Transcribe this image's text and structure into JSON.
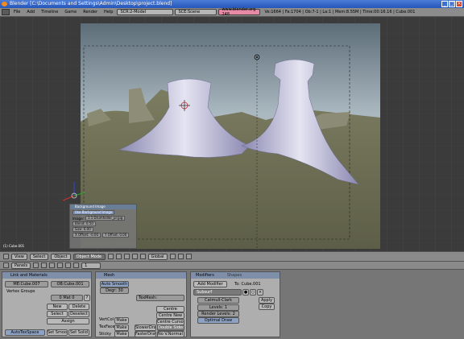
{
  "window": {
    "title": "Blender [C:\\Documents and Settings\\Admin\\Desktop\\project.blend]"
  },
  "menubar": {
    "menus": [
      "File",
      "Add",
      "Timeline",
      "Game",
      "Render",
      "Help"
    ],
    "screen": "SCR:2-Model",
    "scene": "SCE:Scene",
    "url": "www.blender.org 248",
    "stats": "Ve:1664 | Fa:1704 | Ob:7-1 | La:1 | Mem:8.55M | Time:00:16.16 | Cube.001"
  },
  "viewport": {
    "object_label": "(1) Cube.001"
  },
  "bg_panel": {
    "header": "Background Image",
    "use_label": "Use Background Image",
    "image_label": "Image:",
    "image_file": "1.1 Drumheller_pr.jpg",
    "blend_label": "Blend: 0.50",
    "size_label": "Size: 6.00",
    "xoff_label": "X Offset: -0.00",
    "yoff_label": "Y Offset: 0.00"
  },
  "header3d": {
    "view": "View",
    "select": "Select",
    "object": "Object",
    "mode": "Object Mode",
    "orientation": "Global"
  },
  "headerbtns": {
    "panels": "Panels",
    "frame": "1"
  },
  "link_panel": {
    "header": "Link and Materials",
    "me_field": "ME:Cube.007",
    "ob_field": "OB:Cube.001",
    "vertex_groups": "Vertex Groups",
    "mat_field": "0 Mat 0",
    "new": "New",
    "delete": "Delete",
    "select": "Select",
    "deselect": "Deselect",
    "assign": "Assign",
    "autotexspace": "AutoTexSpace",
    "set_smooth": "Set Smooth",
    "set_solid": "Set Solid"
  },
  "mesh_panel": {
    "header": "Mesh",
    "auto_smooth": "Auto Smooth",
    "degr": "Degr: 30",
    "texmesh": "TexMesh:",
    "centre": "Centre",
    "centre_new": "Centre New",
    "centre_cursor": "Centre Cursor",
    "vertcol": "VertCol",
    "texface": "TexFace",
    "sticky": "Sticky",
    "make": "Make",
    "slower_draw": "SlowerDraw",
    "faster_draw": "FasterDraw",
    "double_sided": "Double Sided",
    "no_vnormal_flip": "No V.Normal Flip"
  },
  "modifiers_panel": {
    "tabs": [
      "Modifiers",
      "Shapes"
    ],
    "add_modifier": "Add Modifier",
    "to": "To: Cube.001",
    "modifier_name": "Subsurf",
    "apply": "Apply",
    "copy": "Copy",
    "subdiv_type": "Catmull-Clark",
    "levels": "Levels: 1",
    "render_levels": "Render Levels: 2",
    "optimal_draw": "Optimal Draw"
  },
  "colors": {
    "accent_blue": "#8ea3c4",
    "panel_bg": "#aeaeae",
    "title_blue": "#2656b9"
  }
}
